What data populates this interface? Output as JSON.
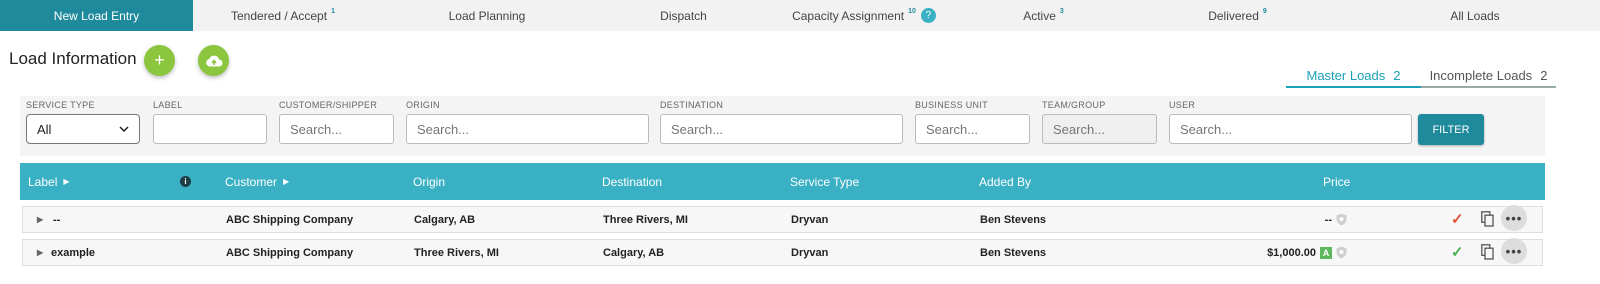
{
  "tabs": [
    {
      "label": "New Load Entry",
      "count": ""
    },
    {
      "label": "Tendered / Accept",
      "count": "1"
    },
    {
      "label": "Load Planning",
      "count": ""
    },
    {
      "label": "Dispatch",
      "count": ""
    },
    {
      "label": "Capacity Assignment",
      "count": "10"
    },
    {
      "label": "Active",
      "count": "3"
    },
    {
      "label": "Delivered",
      "count": "9"
    },
    {
      "label": "All Loads",
      "count": ""
    }
  ],
  "capacity_help": "?",
  "header": {
    "title": "Load Information",
    "add_symbol": "+"
  },
  "subtabs": [
    {
      "label": "Master Loads",
      "count": "2"
    },
    {
      "label": "Incomplete Loads",
      "count": "2"
    }
  ],
  "filters": {
    "service_type": {
      "label": "SERVICE TYPE",
      "value": "All"
    },
    "label": {
      "label": "LABEL",
      "placeholder": ""
    },
    "customer": {
      "label": "CUSTOMER/SHIPPER",
      "placeholder": "Search..."
    },
    "origin": {
      "label": "ORIGIN",
      "placeholder": "Search..."
    },
    "destination": {
      "label": "DESTINATION",
      "placeholder": "Search..."
    },
    "business_unit": {
      "label": "BUSINESS UNIT",
      "placeholder": "Search..."
    },
    "team": {
      "label": "TEAM/GROUP",
      "placeholder": "Search..."
    },
    "user": {
      "label": "USER",
      "placeholder": "Search..."
    },
    "button": "FILTER"
  },
  "table": {
    "columns": {
      "label": "Label",
      "customer": "Customer",
      "origin": "Origin",
      "destination": "Destination",
      "service_type": "Service Type",
      "added_by": "Added By",
      "price": "Price"
    },
    "info_symbol": "i",
    "rows": [
      {
        "label": "--",
        "customer": "ABC Shipping Company",
        "origin": "Calgary, AB",
        "destination": "Three Rivers, MI",
        "service_type": "Dryvan",
        "added_by": "Ben Stevens",
        "price": "--",
        "badge": "",
        "check_color": "#e0503a"
      },
      {
        "label": "example",
        "customer": "ABC Shipping Company",
        "origin": "Three Rivers, MI",
        "destination": "Calgary, AB",
        "service_type": "Dryvan",
        "added_by": "Ben Stevens",
        "price": "$1,000.00",
        "badge": "A",
        "check_color": "#4caf50"
      }
    ]
  },
  "colors": {
    "primary": "#1f8a9c",
    "header": "#3ab0c4",
    "accent_green": "#8cc63f"
  }
}
